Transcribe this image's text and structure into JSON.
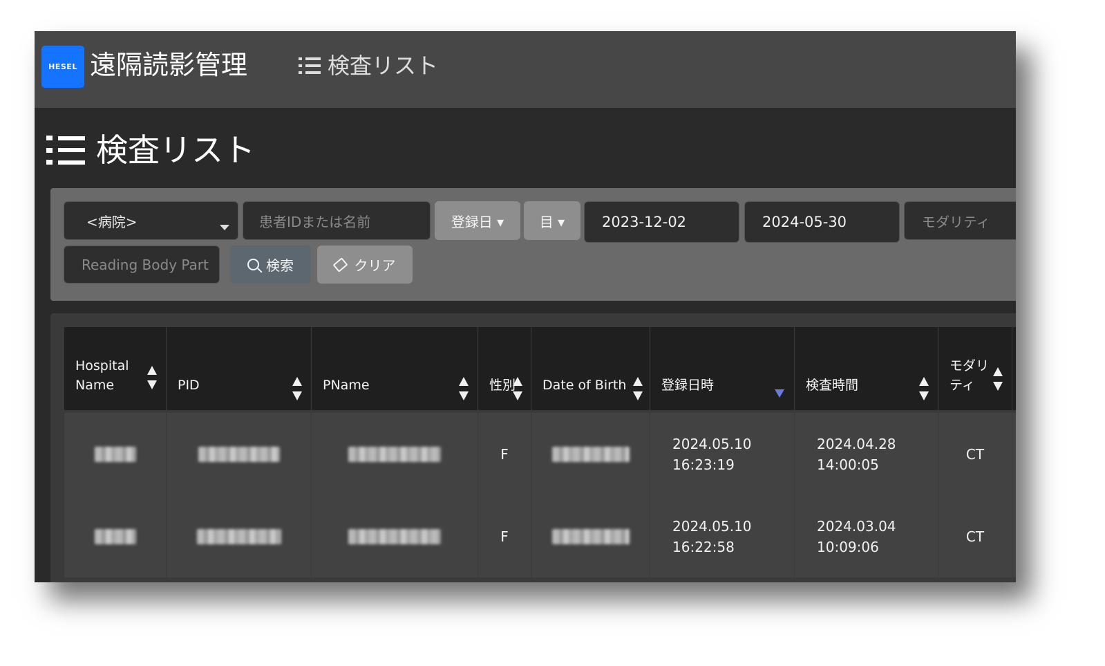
{
  "header": {
    "logo_text": "HESEL",
    "app_title": "遠隔読影管理",
    "nav_label": "検査リスト"
  },
  "page": {
    "title": "検査リスト"
  },
  "filters": {
    "hospital_select": "<病院>",
    "patient_placeholder": "患者IDまたは名前",
    "date_type_label": "登録日 ▾",
    "range_label": "目 ▾",
    "date_from": "2023-12-02",
    "date_to": "2024-05-30",
    "modality_placeholder": "モダリティ",
    "body_part_placeholder": "Reading Body Part",
    "search_label": "検索",
    "clear_label": "クリア"
  },
  "table": {
    "columns": [
      {
        "key": "hospital",
        "label_line1": "Hospital",
        "label_line2": "Name"
      },
      {
        "key": "pid",
        "label_line1": "",
        "label_line2": "PID"
      },
      {
        "key": "pname",
        "label_line1": "",
        "label_line2": "PName"
      },
      {
        "key": "sex",
        "label_line1": "",
        "label_line2": "性別"
      },
      {
        "key": "dob",
        "label_line1": "",
        "label_line2": "Date of Birth"
      },
      {
        "key": "registered",
        "label_line1": "",
        "label_line2": "登録日時"
      },
      {
        "key": "exam_time",
        "label_line1": "",
        "label_line2": "検査時間"
      },
      {
        "key": "modality",
        "label_line1": "モダリ",
        "label_line2": "ティ"
      }
    ],
    "rows": [
      {
        "sex": "F",
        "registered_date": "2024.05.10",
        "registered_time": "16:23:19",
        "exam_date": "2024.04.28",
        "exam_time": "14:00:05",
        "modality": "CT"
      },
      {
        "sex": "F",
        "registered_date": "2024.05.10",
        "registered_time": "16:22:58",
        "exam_date": "2024.03.04",
        "exam_time": "10:09:06",
        "modality": "CT"
      }
    ]
  }
}
